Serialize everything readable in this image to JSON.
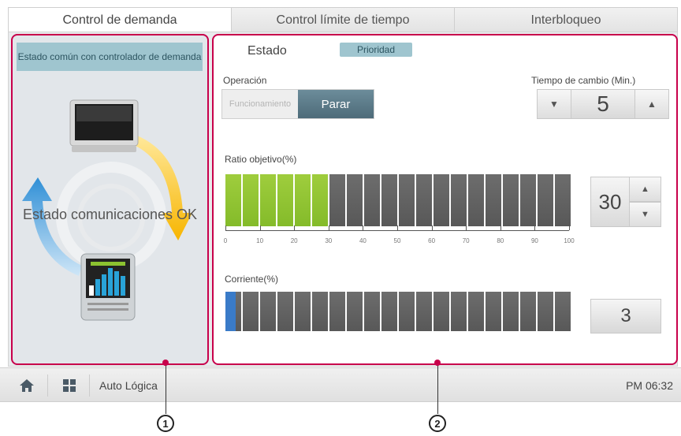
{
  "tabs": [
    {
      "label": "Control de demanda",
      "active": true
    },
    {
      "label": "Control límite de tiempo",
      "active": false
    },
    {
      "label": "Interbloqueo",
      "active": false
    }
  ],
  "left_panel": {
    "title": "Estado común con controlador de demanda",
    "comm_status": "Estado comunicaciones OK"
  },
  "right_panel": {
    "state_label": "Estado",
    "priority_badge": "Prioridad",
    "operation": {
      "label": "Operación",
      "on_label": "Funcionamiento",
      "off_label": "Parar",
      "selected": "Parar"
    },
    "change_time": {
      "label": "Tiempo de cambio (Min.)",
      "value": "5"
    },
    "target_ratio": {
      "label": "Ratio objetivo(%)",
      "value": "30",
      "percent": 30,
      "segments": 20,
      "scale_labels": [
        "0",
        "10",
        "20",
        "30",
        "40",
        "50",
        "60",
        "70",
        "80",
        "90",
        "100"
      ]
    },
    "current": {
      "label": "Corriente(%)",
      "value": "3",
      "percent": 3,
      "segments": 20
    }
  },
  "bottom_bar": {
    "app_name": "Auto Lógica",
    "clock": "PM 06:32"
  },
  "callouts": [
    "1",
    "2"
  ],
  "colors": {
    "accent": "#c8004b",
    "green": "#8cc230",
    "blue": "#3a7bc8",
    "header_teal": "#9fc5cf"
  }
}
